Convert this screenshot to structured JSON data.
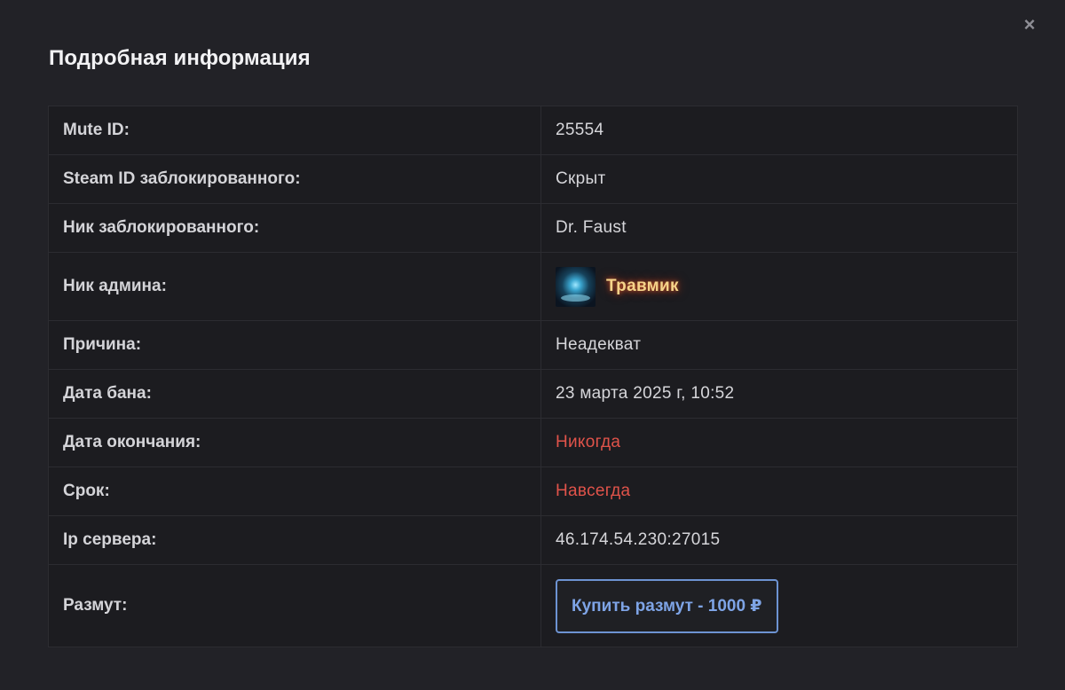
{
  "modal": {
    "title": "Подробная информация",
    "close_symbol": "×"
  },
  "rows": [
    {
      "label": "Mute ID:",
      "value": "25554"
    },
    {
      "label": "Steam ID заблокированного:",
      "value": "Скрыт"
    },
    {
      "label": "Ник заблокированного:",
      "value": "Dr. Faust"
    },
    {
      "label": "Ник админа:",
      "value": "Травмик",
      "avatar_icon": "admin-avatar"
    },
    {
      "label": "Причина:",
      "value": "Неадекват"
    },
    {
      "label": "Дата бана:",
      "value": "23 марта 2025 г, 10:52"
    },
    {
      "label": "Дата окончания:",
      "value": "Никогда"
    },
    {
      "label": "Срок:",
      "value": "Навсегда"
    },
    {
      "label": "Ip сервера:",
      "value": "46.174.54.230:27015"
    },
    {
      "label": "Размут:",
      "button_label": "Купить размут - 1000 ₽"
    }
  ],
  "colors": {
    "background": "#222227",
    "accent_red": "#e0534a",
    "button_blue": "#6d93d2",
    "admin_name": "#f5d48a"
  }
}
